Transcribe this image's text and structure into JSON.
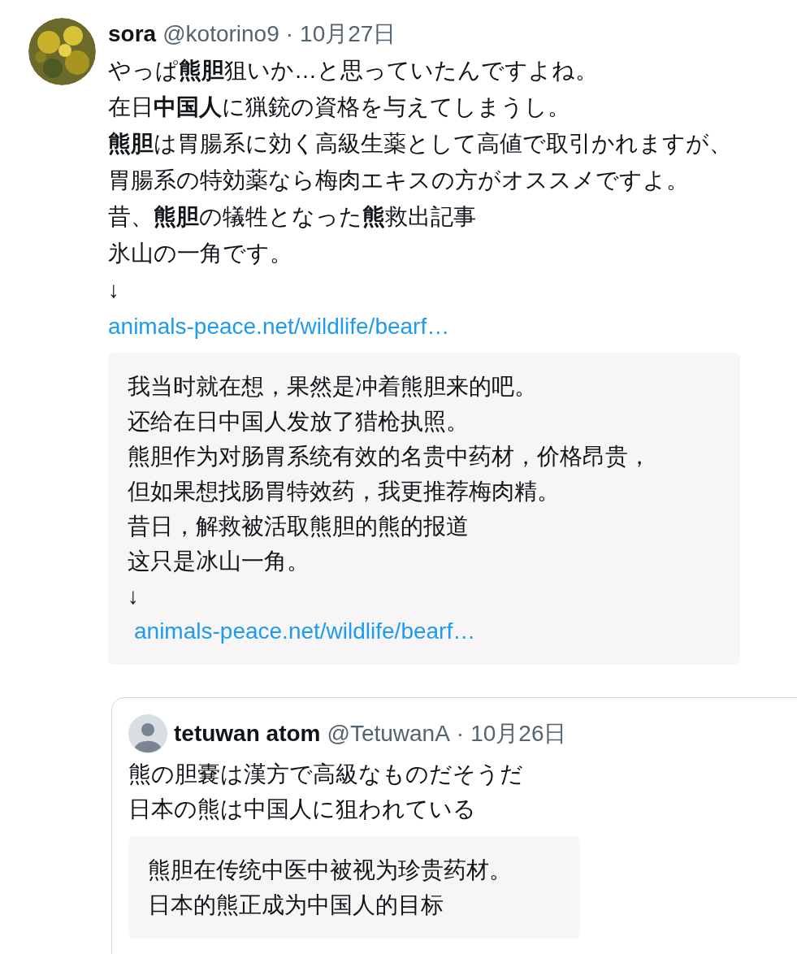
{
  "post": {
    "name": "sora",
    "handle": "@kotorino9",
    "separator": "·",
    "date": "10月27日",
    "lines": [
      "やっぱ**熊胆**狙いか…と思っていたんですよね。",
      "在日**中国人**に猟銃の資格を与えてしまうし。",
      "**熊胆**は胃腸系に効く高級生薬として高値で取引かれますが、",
      "胃腸系の特効薬なら梅肉エキスの方がオススメですよ。",
      "昔、**熊胆**の犠牲となった**熊**救出記事",
      "氷山の一角です。",
      "↓"
    ],
    "link": "animals-peace.net/wildlife/bearf…",
    "translation": {
      "lines": [
        "我当时就在想，果然是冲着熊胆来的吧。",
        "还给在日中国人发放了猎枪执照。",
        "熊胆作为对肠胃系统有效的名贵中药材，价格昂贵，",
        "但如果想找肠胃特效药，我更推荐梅肉精。",
        "昔日，解救被活取熊胆的熊的报道",
        "这只是冰山一角。",
        "↓"
      ],
      "link": "animals-peace.net/wildlife/bearf…"
    }
  },
  "quoted": {
    "name": "tetuwan atom",
    "handle": "@TetuwanA",
    "separator": "·",
    "date": "10月26日",
    "lines": [
      "熊の胆嚢は漢方で高級なものだそうだ",
      "日本の熊は中国人に狙われている"
    ],
    "translation": {
      "lines": [
        "熊胆在传统中医中被视为珍贵药材。",
        "日本的熊正成为中国人的目标"
      ]
    }
  }
}
